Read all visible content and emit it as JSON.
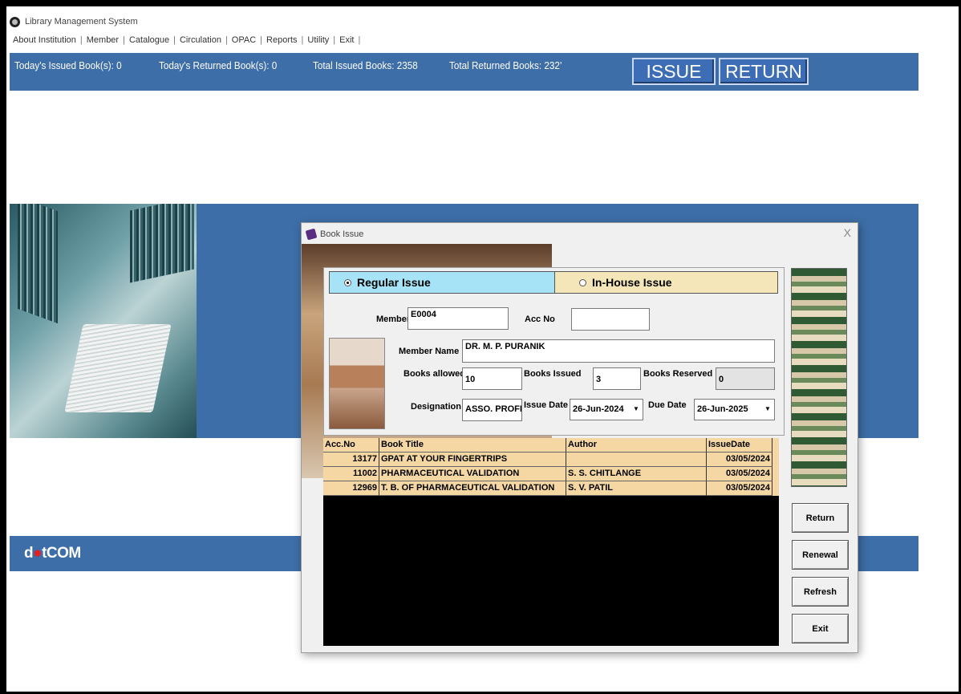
{
  "app": {
    "title": "Library Management System",
    "menu": [
      "About Institution",
      "Member",
      "Catalogue",
      "Circulation",
      "OPAC",
      "Reports",
      "Utility",
      "Exit"
    ]
  },
  "stats": {
    "todays_issued": "Today's Issued Book(s): 0",
    "todays_returned": "Today's Returned Book(s): 0",
    "total_issued": "Total Issued Books: 2358",
    "total_returned": "Total Returned Books: 232’",
    "issue_button": "ISSUE",
    "return_button": "RETURN"
  },
  "brand": {
    "prefix": "d",
    "dot": "●",
    "suffix": "tCOM"
  },
  "dialog": {
    "title": "Book Issue",
    "close": "X",
    "issue_type": {
      "regular": "Regular Issue",
      "inhouse": "In-House Issue",
      "selected": "regular"
    },
    "labels": {
      "member": "Member",
      "acc_no": "Acc No",
      "member_name": "Member Name",
      "books_allowed": "Books allowed",
      "books_issued": "Books Issued",
      "books_reserved": "Books Reserved",
      "designation": "Designation",
      "issue_date": "Issue Date",
      "due_date": "Due Date"
    },
    "values": {
      "member": "E0004",
      "acc_no": "",
      "member_name": "DR. M. P. PURANIK",
      "books_allowed": "10",
      "books_issued": "3",
      "books_reserved": "0",
      "designation": "ASSO. PROFE",
      "issue_date": "26-Jun-2024",
      "due_date": "26-Jun-2025"
    },
    "grid": {
      "columns": [
        "Acc.No",
        "Book Title",
        "Author",
        "IssueDate"
      ],
      "rows": [
        [
          "13177",
          "GPAT AT YOUR FINGERTRIPS",
          "",
          "03/05/2024"
        ],
        [
          "11002",
          "PHARMACEUTICAL VALIDATION",
          "S. S. CHITLANGE",
          "03/05/2024"
        ],
        [
          "12969",
          "T. B. OF PHARMACEUTICAL VALIDATION",
          "S. V. PATIL",
          "03/05/2024"
        ]
      ]
    },
    "buttons": {
      "return": "Return",
      "renewal": "Renewal",
      "refresh": "Refresh",
      "exit": "Exit"
    }
  },
  "colors": {
    "band": "#3e6ea7",
    "grid_row": "#f4d7a3",
    "regular_highlight": "#a6e3f7",
    "inhouse_bg": "#f4e6b8"
  }
}
